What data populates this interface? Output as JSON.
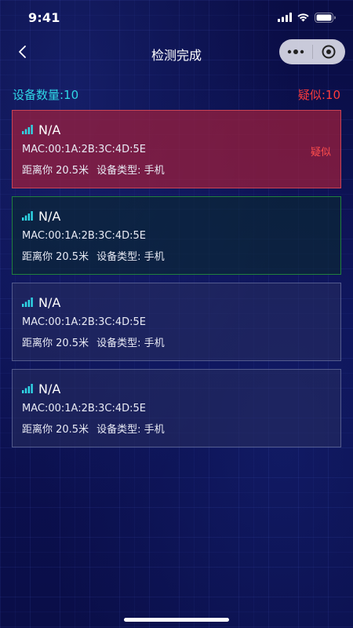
{
  "status_bar": {
    "time": "9:41"
  },
  "nav": {
    "title": "检测完成"
  },
  "summary": {
    "count_label": "设备数量:10",
    "suspect_label": "疑似:10"
  },
  "devices": [
    {
      "name": "N/A",
      "mac": "MAC:00:1A:2B:3C:4D:5E",
      "distance": "距离你 20.5米",
      "type": "设备类型: 手机",
      "flag": "疑似",
      "status": "suspect"
    },
    {
      "name": "N/A",
      "mac": "MAC:00:1A:2B:3C:4D:5E",
      "distance": "距离你 20.5米",
      "type": "设备类型: 手机",
      "flag": "",
      "status": "safe"
    },
    {
      "name": "N/A",
      "mac": "MAC:00:1A:2B:3C:4D:5E",
      "distance": "距离你 20.5米",
      "type": "设备类型: 手机",
      "flag": "",
      "status": "normal"
    },
    {
      "name": "N/A",
      "mac": "MAC:00:1A:2B:3C:4D:5E",
      "distance": "距离你 20.5米",
      "type": "设备类型: 手机",
      "flag": "",
      "status": "normal"
    }
  ],
  "colors": {
    "accent": "#2fd7e6",
    "danger": "#ff3b3b",
    "background": "#0b0f4a"
  },
  "icons": [
    "cellular-signal-icon",
    "wifi-icon",
    "battery-icon",
    "back-chevron-icon",
    "more-dots-icon",
    "close-target-icon",
    "signal-strength-icon"
  ]
}
